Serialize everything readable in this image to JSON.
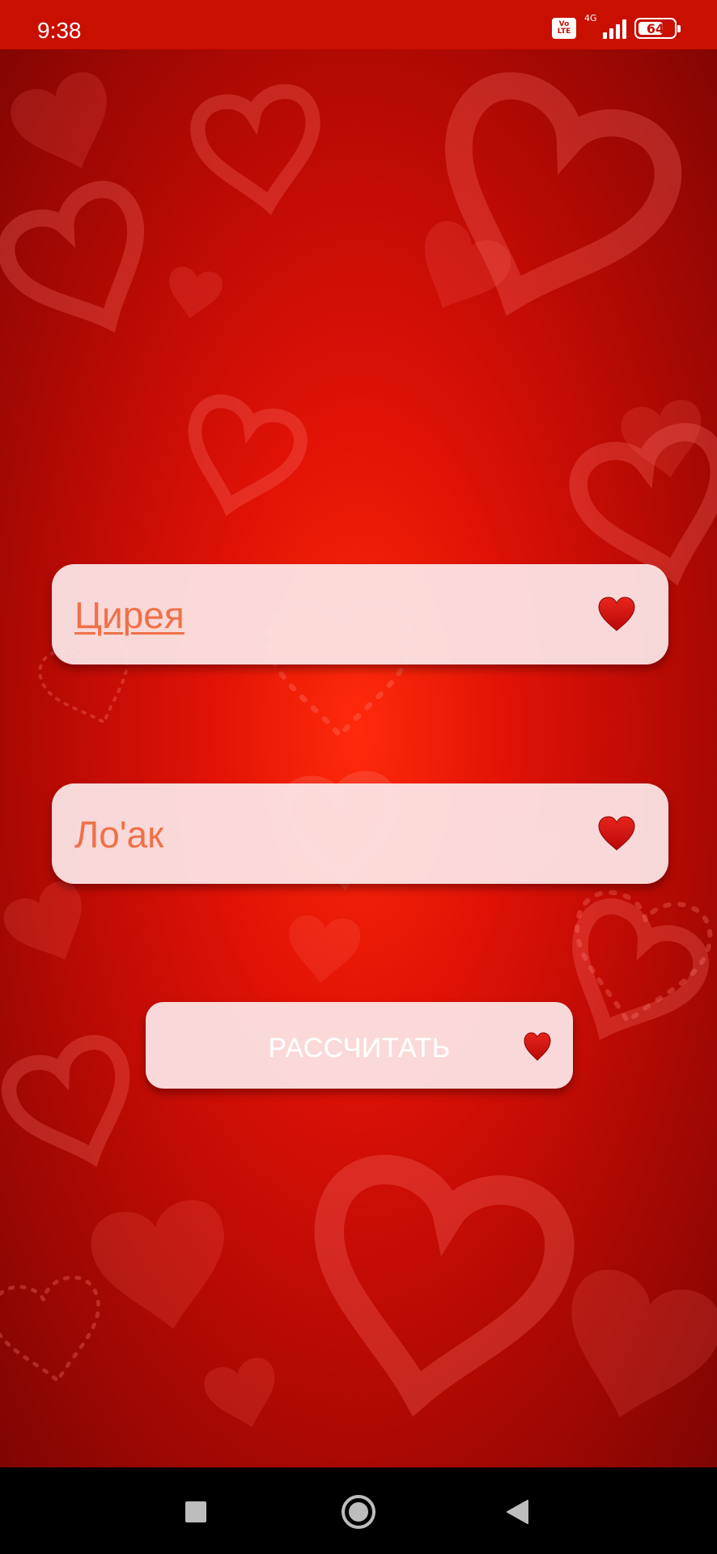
{
  "status_bar": {
    "time": "9:38",
    "volte_line1": "Vo",
    "volte_line2": "LTE",
    "network_type": "4G",
    "battery_level": "64"
  },
  "form": {
    "first_name": {
      "value": "Цирея"
    },
    "second_name": {
      "value": "Ло'ак"
    },
    "calculate_button": {
      "label": "РАССЧИТАТЬ"
    }
  },
  "colors": {
    "accent_text": "#f07048",
    "heart": "#d00f0f",
    "status_bar": "#c80f00"
  },
  "icons": {
    "field_icon": "heart-icon",
    "nav_recents": "square-icon",
    "nav_home": "circle-icon",
    "nav_back": "triangle-back-icon"
  }
}
